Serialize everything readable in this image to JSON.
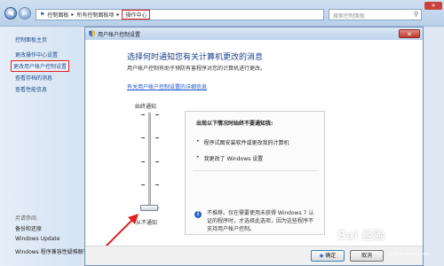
{
  "explorer": {
    "address": [
      "控制面板",
      "所有控制面板项",
      "操作中心"
    ],
    "search_placeholder": "搜索控制面板"
  },
  "sidebar": {
    "items": [
      {
        "label": "控制面板主页"
      },
      {
        "label": "更改操作中心设置"
      },
      {
        "label": "更改用户帐户控制设置"
      },
      {
        "label": "查看存档的消息"
      },
      {
        "label": "查看性能信息"
      }
    ],
    "see_also": "另请参阅",
    "links": [
      "备份和还原",
      "Windows Update",
      "Windows 程序兼容性疑难解答"
    ]
  },
  "dialog": {
    "title": "用户帐户控制设置",
    "heading": "选择何时通知您有关计算机更改的消息",
    "description": "用户帐户控制有助于预防有害程序对您的计算机进行更改。",
    "more_link": "有关用户帐户控制设置的详细信息",
    "slider_top": "始终通知",
    "slider_bottom": "从不通知",
    "slider_level": "0 of 4",
    "info_heading": "出现以下情况时始终不要通知我:",
    "bullets": [
      "程序试图安装软件或更改我的计算机",
      "我更改了 Windows 设置"
    ],
    "note": "不推荐。仅在需要使用未获得 Windows 7 认证的程序时，才选择此选项，因为这些程序不支持用户帐户控制。",
    "ok_label": "确定",
    "cancel_label": "取消"
  },
  "watermark": {
    "text": "Bai 经验",
    "sub": "jingyan.baidu.com"
  },
  "colors": {
    "highlight_box": "#e02020",
    "link_blue": "#1d4b8f",
    "heading_blue": "#1a3d8a"
  }
}
